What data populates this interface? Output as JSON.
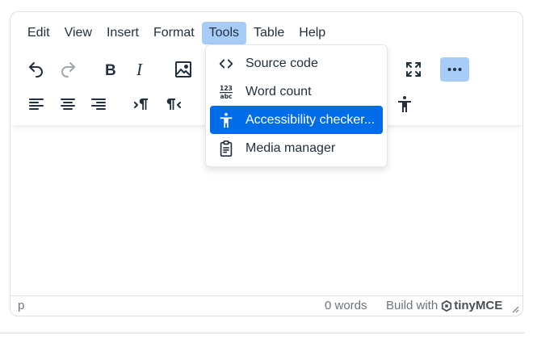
{
  "menubar": {
    "items": [
      "Edit",
      "View",
      "Insert",
      "Format",
      "Tools",
      "Table",
      "Help"
    ],
    "active": "Tools"
  },
  "toolbar": {
    "row1": [
      "undo-icon",
      "redo-icon",
      "bold-icon",
      "italic-icon",
      "image-icon",
      "fullscreen-icon",
      "more-icon"
    ],
    "row2": [
      "align-left-icon",
      "align-center-icon",
      "align-right-icon",
      "ltr-icon",
      "rtl-icon",
      "accessibility-icon"
    ]
  },
  "tools_menu": {
    "items": [
      {
        "label": "Source code",
        "icon": "source-code-icon"
      },
      {
        "label": "Word count",
        "icon": "word-count-icon"
      },
      {
        "label": "Accessibility checker...",
        "icon": "accessibility-icon"
      },
      {
        "label": "Media manager",
        "icon": "media-manager-icon"
      }
    ],
    "highlighted": "Accessibility checker..."
  },
  "statusbar": {
    "path": "p",
    "word_count": "0 words",
    "build_label": "Build with",
    "brand": "tinyMCE"
  },
  "colors": {
    "accent": "#006ce7",
    "active_bg": "#a6ccf7",
    "text": "#222f3e"
  }
}
